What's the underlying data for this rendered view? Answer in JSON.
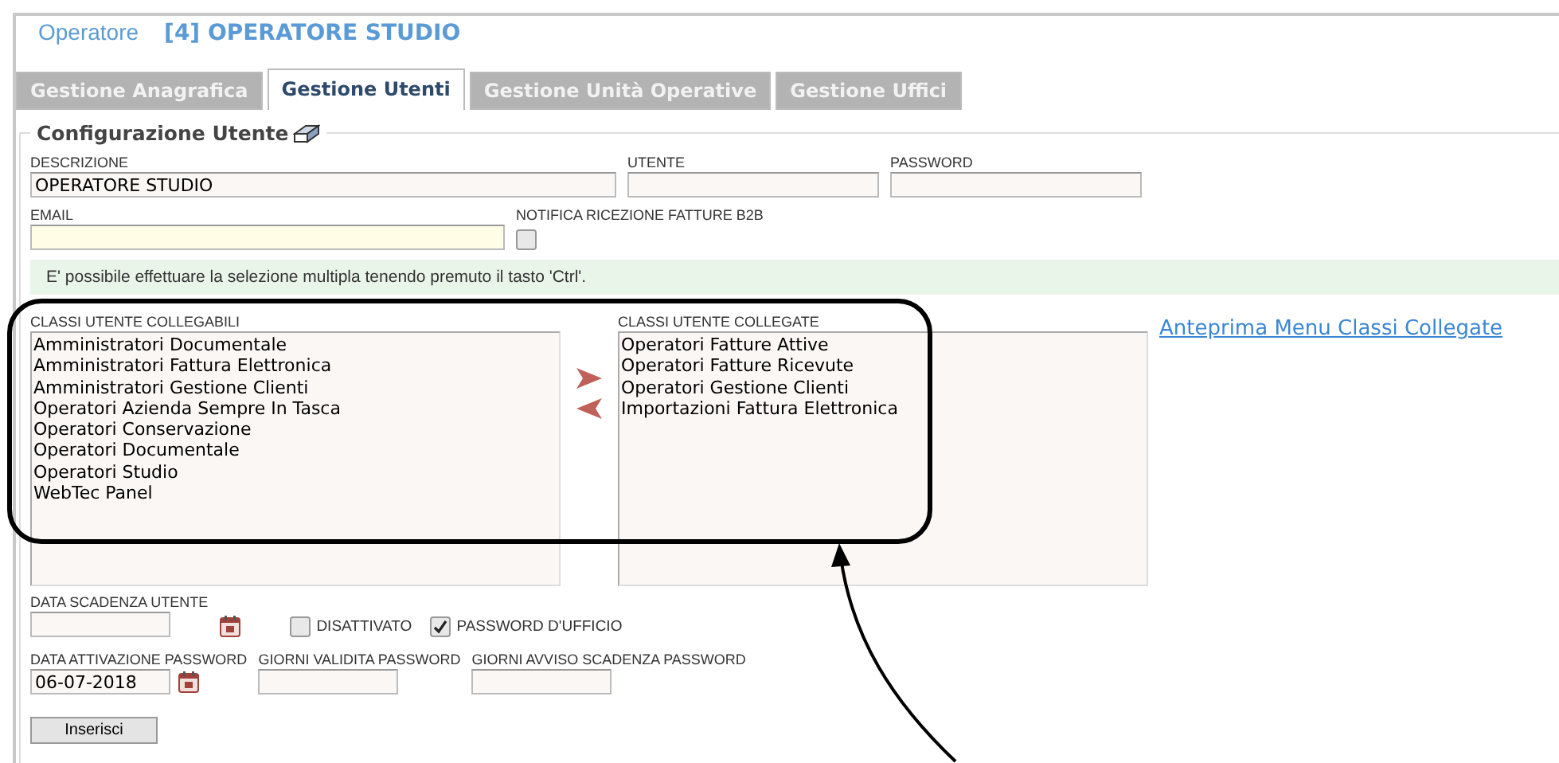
{
  "header": {
    "section": "Operatore",
    "title": "[4] OPERATORE STUDIO"
  },
  "tabs": [
    {
      "label": "Gestione Anagrafica",
      "selected": false
    },
    {
      "label": "Gestione Utenti",
      "selected": true
    },
    {
      "label": "Gestione Unità Operative",
      "selected": false
    },
    {
      "label": "Gestione Uffici",
      "selected": false
    }
  ],
  "panel": {
    "legend": "Configurazione Utente",
    "descrizione": {
      "label": "DESCRIZIONE",
      "value": "OPERATORE STUDIO"
    },
    "utente": {
      "label": "UTENTE"
    },
    "password": {
      "label": "PASSWORD"
    },
    "email": {
      "label": "EMAIL"
    },
    "notifica": {
      "label": "NOTIFICA RICEZIONE FATTURE B2B",
      "checked": false
    },
    "hint": "E' possibile effettuare la selezione multipla tenendo premuto il tasto 'Ctrl'.",
    "available": {
      "label": "CLASSI UTENTE COLLEGABILI",
      "items": [
        "Amministratori Documentale",
        "Amministratori Fattura Elettronica",
        "Amministratori Gestione Clienti",
        "Operatori Azienda Sempre In Tasca",
        "Operatori Conservazione",
        "Operatori Documentale",
        "Operatori Studio",
        "WebTec Panel"
      ]
    },
    "linked": {
      "label": "CLASSI UTENTE COLLEGATE",
      "items": [
        "Operatori Fatture Attive",
        "Operatori Fatture Ricevute",
        "Operatori Gestione Clienti",
        "Importazioni Fattura Elettronica"
      ]
    },
    "preview_link": "Anteprima Menu Classi Collegate",
    "scadenza": {
      "label": "DATA SCADENZA UTENTE"
    },
    "disattivato": {
      "label": "DISATTIVATO",
      "checked": false
    },
    "password_ufficio": {
      "label": "PASSWORD D'UFFICIO",
      "checked": true
    },
    "attivazione": {
      "label": "DATA ATTIVAZIONE PASSWORD",
      "value": "06-07-2018"
    },
    "validita": {
      "label": "GIORNI VALIDITA PASSWORD"
    },
    "avviso": {
      "label": "GIORNI AVVISO SCADENZA PASSWORD"
    },
    "submit": "Inserisci"
  }
}
